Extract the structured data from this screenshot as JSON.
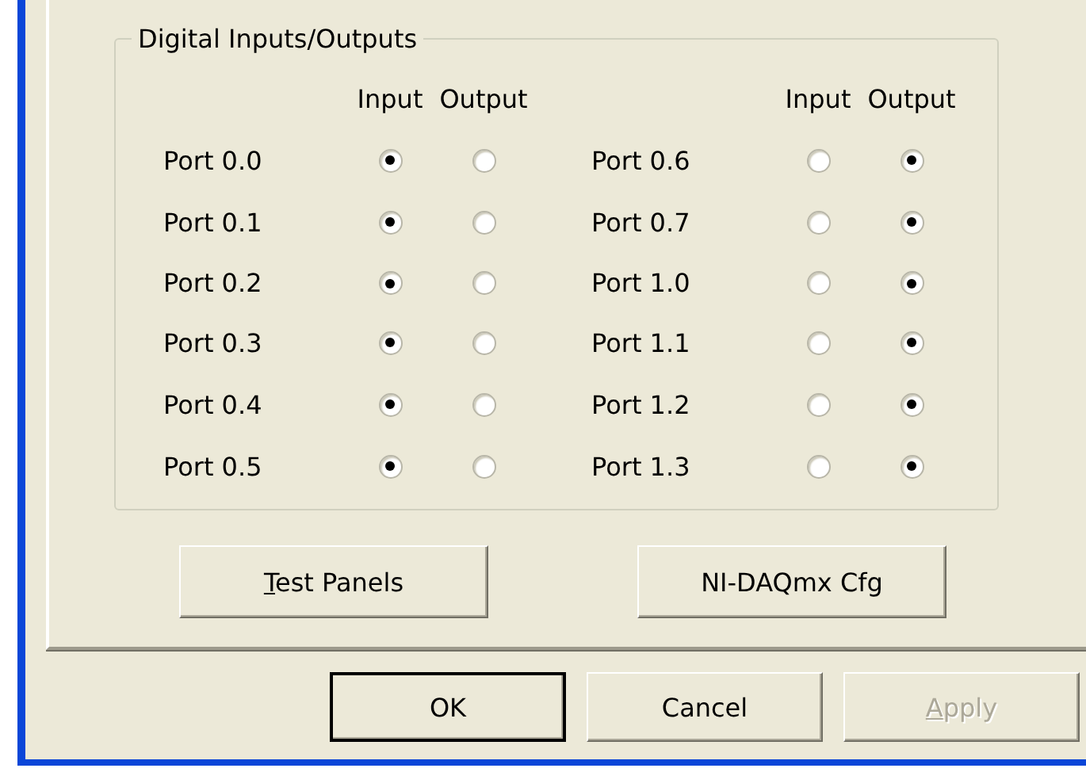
{
  "group": {
    "title": "Digital Inputs/Outputs",
    "columns": [
      {
        "headers": [
          "Input",
          "Output"
        ],
        "ports": [
          {
            "label": "Port 0.0",
            "radios": [
              {
                "selected": true
              },
              {
                "selected": false
              }
            ]
          },
          {
            "label": "Port 0.1",
            "radios": [
              {
                "selected": true
              },
              {
                "selected": false
              }
            ]
          },
          {
            "label": "Port 0.2",
            "radios": [
              {
                "selected": true
              },
              {
                "selected": false
              }
            ]
          },
          {
            "label": "Port 0.3",
            "radios": [
              {
                "selected": true
              },
              {
                "selected": false
              }
            ]
          },
          {
            "label": "Port 0.4",
            "radios": [
              {
                "selected": true
              },
              {
                "selected": false
              }
            ]
          },
          {
            "label": "Port 0.5",
            "radios": [
              {
                "selected": true
              },
              {
                "selected": false
              }
            ]
          }
        ]
      },
      {
        "headers": [
          "Input",
          "Output"
        ],
        "ports": [
          {
            "label": "Port 0.6",
            "radios": [
              {
                "selected": false
              },
              {
                "selected": true
              }
            ]
          },
          {
            "label": "Port 0.7",
            "radios": [
              {
                "selected": false
              },
              {
                "selected": true
              }
            ]
          },
          {
            "label": "Port 1.0",
            "radios": [
              {
                "selected": false
              },
              {
                "selected": true
              }
            ]
          },
          {
            "label": "Port 1.1",
            "radios": [
              {
                "selected": false
              },
              {
                "selected": true
              }
            ]
          },
          {
            "label": "Port 1.2",
            "radios": [
              {
                "selected": false
              },
              {
                "selected": true
              }
            ]
          },
          {
            "label": "Port 1.3",
            "radios": [
              {
                "selected": false
              },
              {
                "selected": true
              }
            ]
          }
        ]
      }
    ]
  },
  "panel_buttons": [
    {
      "label": "Test Panels",
      "access_key_underlined": true
    },
    {
      "label": "NI-DAQmx Cfg",
      "access_key_underlined": false
    }
  ],
  "dialog_buttons": [
    {
      "label": "OK",
      "access_key_underlined": false,
      "default": true,
      "disabled": false
    },
    {
      "label": "Cancel",
      "access_key_underlined": false,
      "default": false,
      "disabled": false
    },
    {
      "label": "Apply",
      "access_key_underlined": true,
      "default": false,
      "disabled": true
    }
  ]
}
